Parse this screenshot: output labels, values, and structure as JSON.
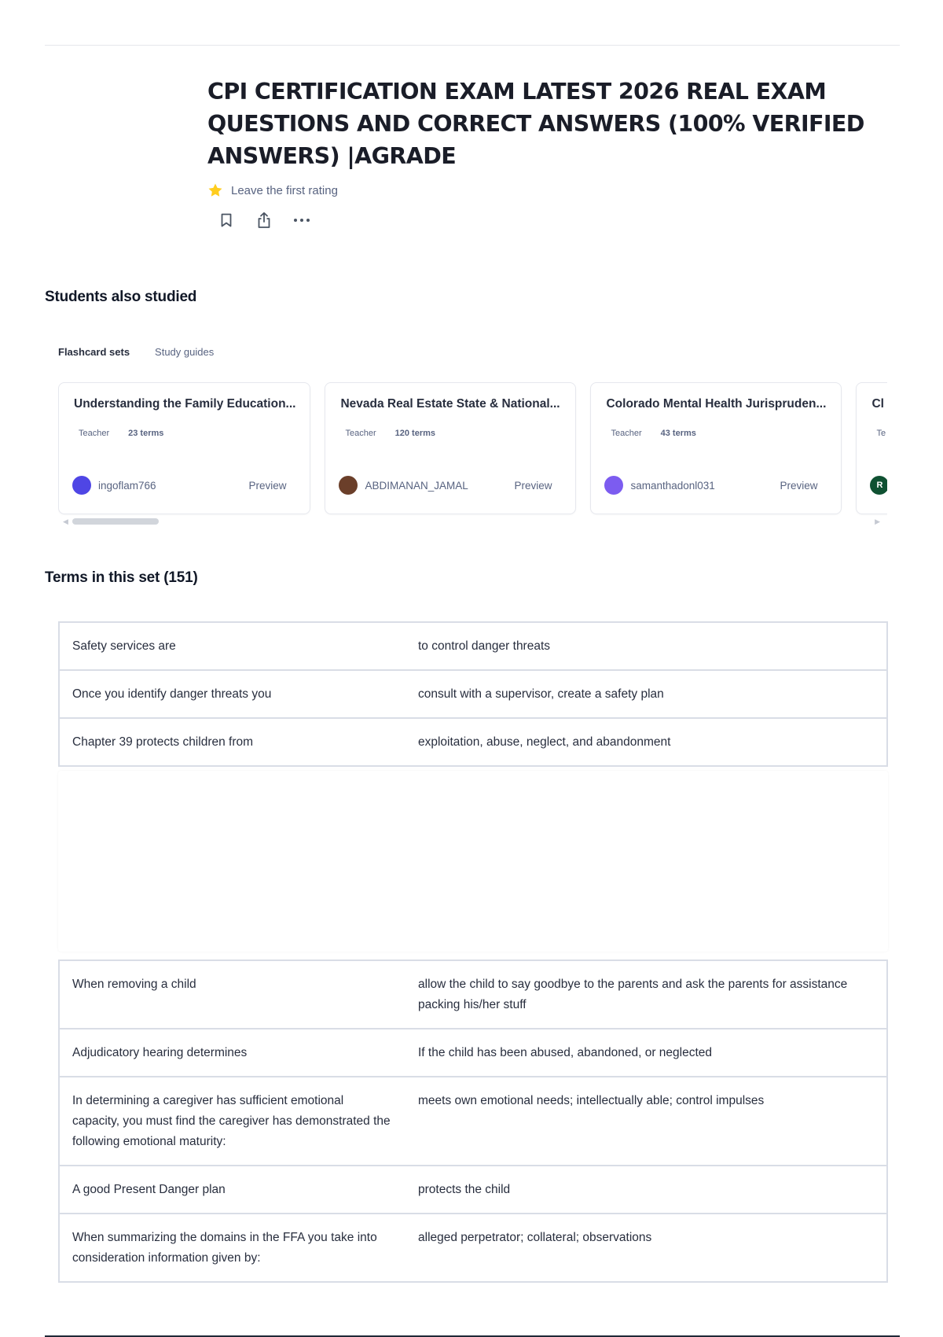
{
  "document": {
    "title": "CPI CERTIFICATION EXAM LATEST 2026 REAL EXAM QUESTIONS AND CORRECT ANSWERS (100% VERIFIED ANSWERS) |AGRADE",
    "rating_text": "Leave the first rating"
  },
  "icons": {
    "rating": "star-icon",
    "save": "bookmark-icon",
    "share": "share-icon",
    "more": "more-dots-icon"
  },
  "colors": {
    "star": "#FFCD1F",
    "text": "#282E3E",
    "muted": "#586380",
    "border": "#D9DDE6"
  },
  "students_also_studied": {
    "heading": "Students also studied",
    "tabs": [
      "Flashcard sets",
      "Study guides"
    ],
    "cards": [
      {
        "title": "Understanding the Family Education...",
        "role": "Teacher",
        "terms": "23 terms",
        "user": "ingoflam766",
        "avatar_color": "#4f46e5",
        "avatar_letter": "",
        "preview": "Preview"
      },
      {
        "title": "Nevada Real Estate State & National...",
        "role": "Teacher",
        "terms": "120 terms",
        "user": "ABDIMANAN_JAMAL",
        "avatar_color": "#6b3f2a",
        "avatar_letter": "",
        "preview": "Preview"
      },
      {
        "title": "Colorado Mental Health Jurispruden...",
        "role": "Teacher",
        "terms": "43 terms",
        "user": "samanthadonl031",
        "avatar_color": "#7c5cf0",
        "avatar_letter": "",
        "preview": "Preview"
      },
      {
        "title": "Cl",
        "role": "Te",
        "terms": "",
        "user": "",
        "avatar_color": "#0f5132",
        "avatar_letter": "R",
        "preview": ""
      }
    ]
  },
  "terms_section": {
    "heading": "Terms in this set (151)",
    "group1": [
      {
        "term": "Safety services are",
        "definition": "to control danger threats"
      },
      {
        "term": "Once you identify danger threats you",
        "definition": "consult with a supervisor, create a safety plan"
      },
      {
        "term": "Chapter 39 protects children from",
        "definition": "exploitation, abuse, neglect, and abandonment"
      }
    ],
    "group2": [
      {
        "term": "When removing a child",
        "definition": "allow the child to say goodbye to the parents and ask the parents for assistance packing his/her stuff"
      },
      {
        "term": "Adjudicatory hearing determines",
        "definition": "If the child has been abused, abandoned, or neglected"
      },
      {
        "term": "In determining a caregiver has sufficient emotional capacity, you must find the caregiver has demonstrated the following emotional maturity:",
        "definition": "meets own emotional needs; intellectually able; control impulses"
      },
      {
        "term": "A good Present Danger plan",
        "definition": "protects the child"
      },
      {
        "term": "When summarizing the domains in the FFA you take into consideration information given by:",
        "definition": "alleged perpetrator; collateral; observations"
      }
    ]
  }
}
